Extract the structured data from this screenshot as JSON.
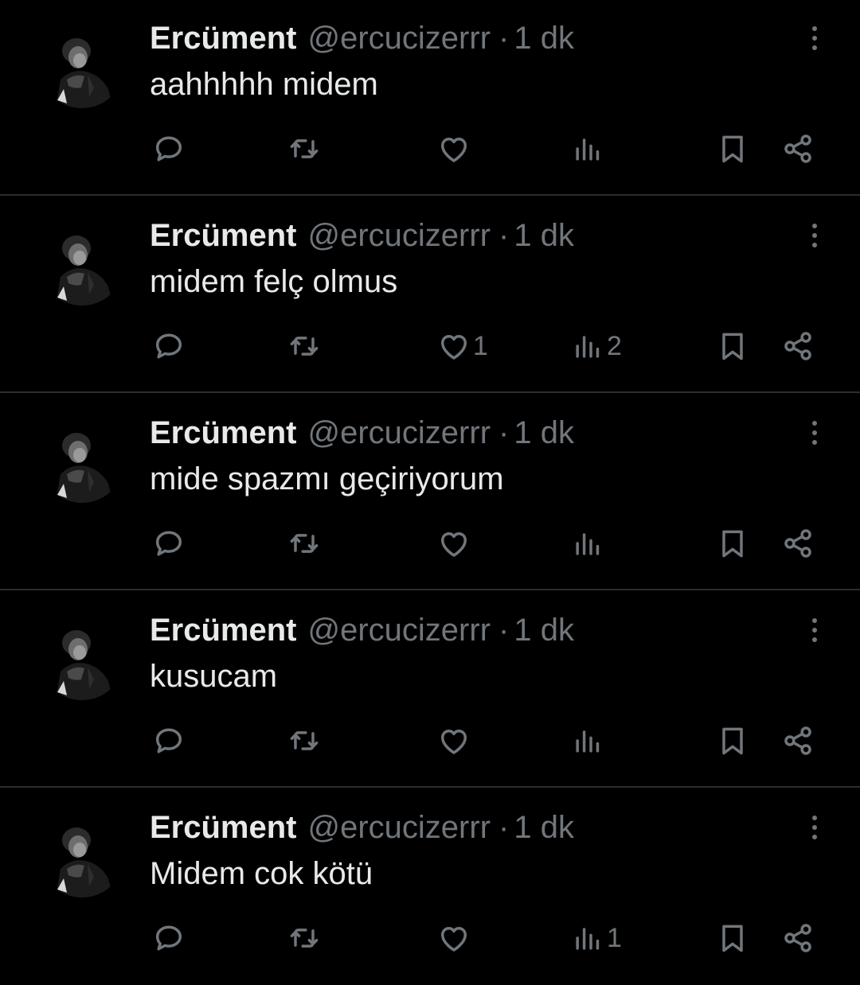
{
  "tweets": [
    {
      "author_name": "Ercüment",
      "author_handle": "@ercucizerrr",
      "separator": "·",
      "time": "1 dk",
      "text": "aahhhhh midem",
      "replies": "",
      "retweets": "",
      "likes": "",
      "views": ""
    },
    {
      "author_name": "Ercüment",
      "author_handle": "@ercucizerrr",
      "separator": "·",
      "time": "1 dk",
      "text": "midem felç olmus",
      "replies": "",
      "retweets": "",
      "likes": "1",
      "views": "2"
    },
    {
      "author_name": "Ercüment",
      "author_handle": "@ercucizerrr",
      "separator": "·",
      "time": "1 dk",
      "text": "mide spazmı geçiriyorum",
      "replies": "",
      "retweets": "",
      "likes": "",
      "views": ""
    },
    {
      "author_name": "Ercüment",
      "author_handle": "@ercucizerrr",
      "separator": "·",
      "time": "1 dk",
      "text": "kusucam",
      "replies": "",
      "retweets": "",
      "likes": "",
      "views": ""
    },
    {
      "author_name": "Ercüment",
      "author_handle": "@ercucizerrr",
      "separator": "·",
      "time": "1 dk",
      "text": "Midem cok kötü",
      "replies": "",
      "retweets": "",
      "likes": "",
      "views": "1"
    }
  ],
  "icons": {
    "more": "more-vertical-icon",
    "reply": "reply-bubble-icon",
    "retweet": "retweet-icon",
    "like": "heart-icon",
    "views": "views-bar-chart-icon",
    "bookmark": "bookmark-icon",
    "share": "share-icon"
  },
  "colors": {
    "background": "#000000",
    "primary_text": "#e7e9ea",
    "secondary_text": "#71767b",
    "divider": "#2a2d31"
  }
}
